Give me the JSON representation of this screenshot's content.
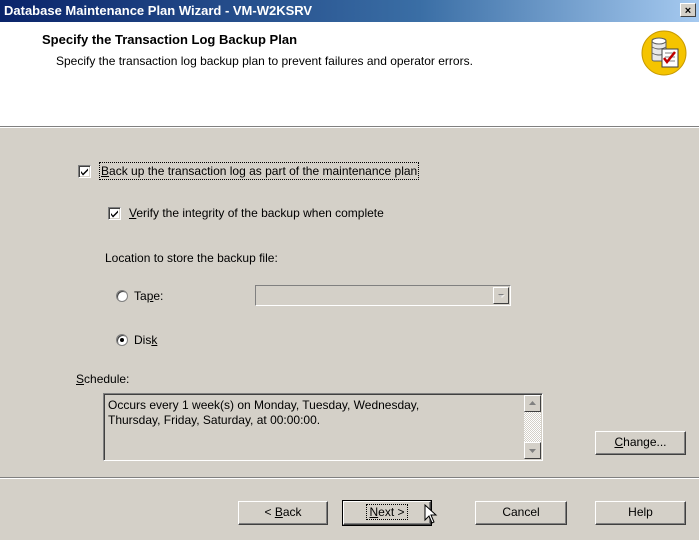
{
  "window": {
    "title": "Database Maintenance Plan Wizard - VM-W2KSRV",
    "close_glyph": "×"
  },
  "header": {
    "title": "Specify the Transaction Log Backup Plan",
    "subtitle": "Specify the transaction log backup plan to prevent failures and operator errors.",
    "icon": "database-checklist-icon"
  },
  "options": {
    "backup_log": {
      "pre": "",
      "accel": "B",
      "post": "ack up the transaction log as part of the maintenance plan",
      "checked": true
    },
    "verify": {
      "pre": "",
      "accel": "V",
      "post": "erify the integrity of the backup when complete",
      "checked": true
    },
    "location_label": "Location to store the backup file:",
    "tape": {
      "pre": "Ta",
      "accel": "p",
      "post": "e:",
      "selected": false
    },
    "tape_device_value": "",
    "disk": {
      "pre": "Dis",
      "accel": "k",
      "post": "",
      "selected": true
    }
  },
  "schedule": {
    "label_accel": "S",
    "label_rest": "chedule:",
    "line1": "Occurs every 1 week(s) on Monday, Tuesday, Wednesday,",
    "line2": "Thursday, Friday, Saturday, at 00:00:00.",
    "change_accel": "C",
    "change_rest": "hange..."
  },
  "buttons": {
    "back": {
      "pre": "< ",
      "accel": "B",
      "post": "ack"
    },
    "next": {
      "pre": "",
      "accel": "N",
      "post": "ext >"
    },
    "cancel": "Cancel",
    "help": "Help"
  }
}
